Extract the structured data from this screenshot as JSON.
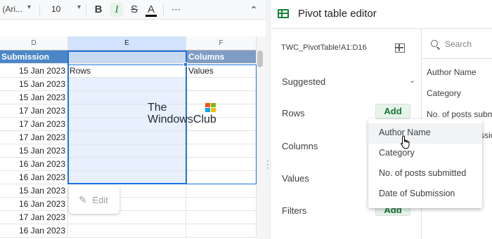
{
  "toolbar": {
    "font_name": "lt (Ari...",
    "font_size": "10",
    "bold_label": "B",
    "italic_label": "I",
    "strike_label": "S",
    "color_label": "A",
    "more_label": "⋯",
    "collapse_label": "⌃"
  },
  "sheet": {
    "columns": [
      "D",
      "E",
      "F"
    ],
    "header_row": {
      "d": "Submission",
      "e": "",
      "f": "Columns"
    },
    "rows": [
      {
        "d": "15 Jan 2023",
        "e": "Rows",
        "f": "Values"
      },
      {
        "d": "15 Jan 2023",
        "e": "",
        "f": ""
      },
      {
        "d": "15 Jan 2023",
        "e": "",
        "f": ""
      },
      {
        "d": "17 Jan 2023",
        "e": "",
        "f": ""
      },
      {
        "d": "17 Jan 2023",
        "e": "",
        "f": ""
      },
      {
        "d": "17 Jan 2023",
        "e": "",
        "f": ""
      },
      {
        "d": "15 Jan 2023",
        "e": "",
        "f": ""
      },
      {
        "d": "16 Jan 2023",
        "e": "",
        "f": ""
      },
      {
        "d": "16 Jan 2023",
        "e": "",
        "f": ""
      },
      {
        "d": "15 Jan 2023",
        "e": "",
        "f": ""
      },
      {
        "d": "16 Jan 2023",
        "e": "",
        "f": ""
      },
      {
        "d": "17 Jan 2023",
        "e": "",
        "f": ""
      },
      {
        "d": "16 Jan 2023",
        "e": "",
        "f": ""
      }
    ],
    "edit_label": "Edit",
    "watermark_line1": "The",
    "watermark_line2": "WindowsClub"
  },
  "pivot": {
    "title": "Pivot table editor",
    "range": "TWC_PivotTable!A1:D16",
    "suggested_label": "Suggested",
    "rows_label": "Rows",
    "columns_label": "Columns",
    "values_label": "Values",
    "filters_label": "Filters",
    "add_label": "Add",
    "search_placeholder": "Search",
    "fields": [
      "Author Name",
      "Category",
      "No. of posts subm",
      "Date of Submissio"
    ],
    "dropdown": [
      "Author Name",
      "Category",
      "No. of posts submitted",
      "Date of Submission"
    ]
  },
  "colors": {
    "accent": "#1a73e8",
    "green": "#188038",
    "header_blue": "#4a86c8"
  }
}
